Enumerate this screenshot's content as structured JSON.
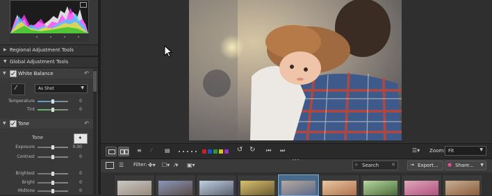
{
  "left_panel": {
    "sections": [
      {
        "label": "Regional Adjustment Tools",
        "expanded": false
      },
      {
        "label": "Global Adjustment Tools",
        "expanded": true
      }
    ],
    "white_balance": {
      "label": "White Balance",
      "preset": "As Shot",
      "rows": [
        {
          "label": "Temperature",
          "value": "0",
          "pos": 0.5
        },
        {
          "label": "Tint",
          "value": "0",
          "pos": 0.5
        }
      ]
    },
    "tone": {
      "label": "Tone",
      "title": "Tone",
      "rows": [
        {
          "label": "Exposure",
          "value": "0.00",
          "pos": 0.5
        },
        {
          "label": "Contrast",
          "value": "0",
          "pos": 0.5
        },
        {
          "label": "Brightest",
          "value": "0",
          "pos": 0.5
        },
        {
          "label": "Bright",
          "value": "0",
          "pos": 0.5
        },
        {
          "label": "Midtone",
          "value": "0",
          "pos": 0.5
        }
      ]
    }
  },
  "toolbar": {
    "color_labels": [
      "#d02020",
      "#2050d0",
      "#2a9a2a",
      "#d8c020",
      "#9a30c0"
    ],
    "zoom_label": "Zoom:",
    "zoom_value": "Fit"
  },
  "filmstrip_bar": {
    "filter_label": "Filter:",
    "search_placeholder": "Search",
    "export_label": "Export...",
    "share_label": "Share..."
  },
  "filmstrip": {
    "selected_index": 4,
    "thumbnails": [
      {
        "name": "thumb-1",
        "colors": [
          "#c8c8c8",
          "#9a8a78"
        ]
      },
      {
        "name": "thumb-2",
        "colors": [
          "#8a98b8",
          "#5a4a48"
        ]
      },
      {
        "name": "thumb-3",
        "colors": [
          "#c0d0e0",
          "#5a6070"
        ]
      },
      {
        "name": "thumb-4",
        "colors": [
          "#d8c070",
          "#6a5a30"
        ]
      },
      {
        "name": "thumb-5",
        "colors": [
          "#b8a8a0",
          "#5a6a8a"
        ]
      },
      {
        "name": "thumb-6",
        "colors": [
          "#e8c8a0",
          "#b07050"
        ]
      },
      {
        "name": "thumb-7",
        "colors": [
          "#b8d8a0",
          "#4a6a3a"
        ]
      },
      {
        "name": "thumb-8",
        "colors": [
          "#e0a8b8",
          "#b05080"
        ]
      },
      {
        "name": "thumb-9",
        "colors": [
          "#c8b090",
          "#8a5a40"
        ]
      }
    ]
  }
}
